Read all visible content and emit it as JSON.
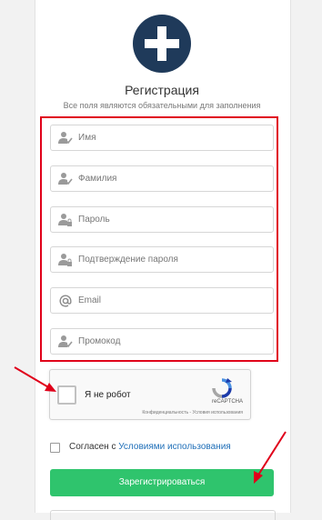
{
  "header": {
    "title": "Регистрация",
    "subtitle": "Все поля являются обязательными для заполнения"
  },
  "form": {
    "fields": [
      {
        "placeholder": "Имя",
        "icon": "user-check-icon"
      },
      {
        "placeholder": "Фамилия",
        "icon": "user-check-icon"
      },
      {
        "placeholder": "Пароль",
        "icon": "user-lock-icon"
      },
      {
        "placeholder": "Подтверждение пароля",
        "icon": "user-lock-icon"
      },
      {
        "placeholder": "Email",
        "icon": "at-sign-icon"
      },
      {
        "placeholder": "Промокод",
        "icon": "user-check-icon"
      }
    ]
  },
  "captcha": {
    "label": "Я не робот",
    "brand": "reCAPTCHA",
    "links": "Конфиденциальность - Условия использования"
  },
  "agree": {
    "prefix": "Согласен с ",
    "link": "Условиями использования"
  },
  "submit_label": "Зарегистрироваться",
  "colors": {
    "accent_green": "#2fc46d",
    "logo_navy": "#1f3a5a",
    "highlight_red": "#e0001a",
    "link_blue": "#1f6fb8"
  }
}
